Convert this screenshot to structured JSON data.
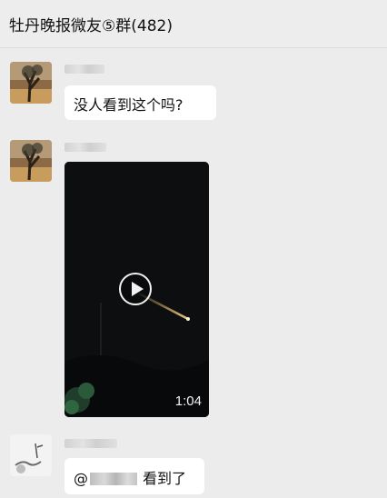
{
  "chat": {
    "title": "牡丹晚报微友⑤群(482)"
  },
  "messages": [
    {
      "type": "text",
      "text": "没人看到这个吗?"
    },
    {
      "type": "video",
      "duration": "1:04",
      "play_icon": "play-icon"
    },
    {
      "type": "text",
      "mention_prefix": "@",
      "text": "看到了"
    }
  ],
  "colors": {
    "background": "#ececec",
    "bubble": "#ffffff",
    "video_bg": "#0d0e10",
    "meteor": "#f2c46a"
  }
}
